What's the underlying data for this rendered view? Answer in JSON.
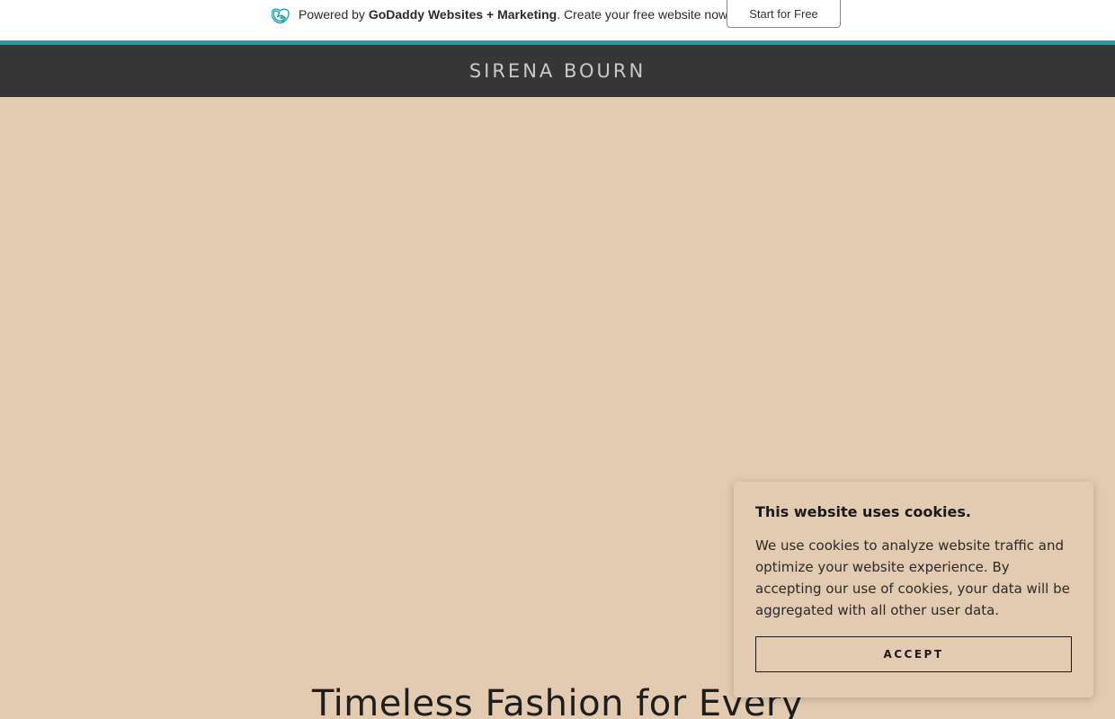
{
  "promo": {
    "powered_by": "Powered by",
    "brand": "GoDaddy Websites + Marketing",
    "tagline": ". Create your free website now.",
    "cta_label": "Start for Free",
    "accent_color": "#1ba1a8"
  },
  "header": {
    "site_title": "SIRENA BOURN"
  },
  "hero": {
    "heading": "Timeless Fashion for Every"
  },
  "cookie_banner": {
    "title": "This website uses cookies.",
    "body": "We use cookies to analyze website traffic and optimize your website experience. By accepting our use of cookies, your data will be aggregated with all other user data.",
    "accept_label": "ACCEPT"
  },
  "colors": {
    "hero_background": "#e3cbb1",
    "header_background": "#363636"
  },
  "icons": {
    "promo_logo": "godaddy-logo-icon"
  }
}
